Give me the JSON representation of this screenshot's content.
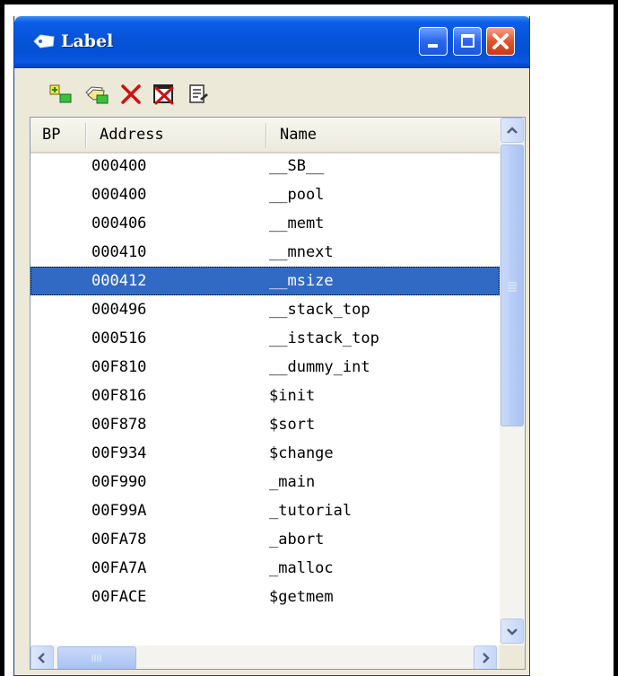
{
  "window": {
    "title": "Label",
    "controls": [
      "minimize",
      "maximize",
      "close"
    ]
  },
  "toolbar": {
    "icons": [
      "add-label-icon",
      "edit-label-icon",
      "delete-icon",
      "delete-all-icon",
      "properties-icon"
    ]
  },
  "table": {
    "columns": [
      "BP",
      "Address",
      "Name"
    ],
    "selected_index": 4,
    "rows": [
      {
        "address": "000400",
        "name": "__SB__"
      },
      {
        "address": "000400",
        "name": "__pool"
      },
      {
        "address": "000406",
        "name": "__memt"
      },
      {
        "address": "000410",
        "name": "__mnext"
      },
      {
        "address": "000412",
        "name": "__msize"
      },
      {
        "address": "000496",
        "name": "__stack_top"
      },
      {
        "address": "000516",
        "name": "__istack_top"
      },
      {
        "address": "00F810",
        "name": "__dummy_int"
      },
      {
        "address": "00F816",
        "name": "$init"
      },
      {
        "address": "00F878",
        "name": "$sort"
      },
      {
        "address": "00F934",
        "name": "$change"
      },
      {
        "address": "00F990",
        "name": "_main"
      },
      {
        "address": "00F99A",
        "name": "_tutorial"
      },
      {
        "address": "00FA78",
        "name": "_abort"
      },
      {
        "address": "00FA7A",
        "name": "_malloc"
      },
      {
        "address": "00FACE",
        "name": "$getmem"
      }
    ]
  },
  "colors": {
    "selection": "#316ac5",
    "titlebar": "#0653d8",
    "face": "#ece9d8"
  }
}
